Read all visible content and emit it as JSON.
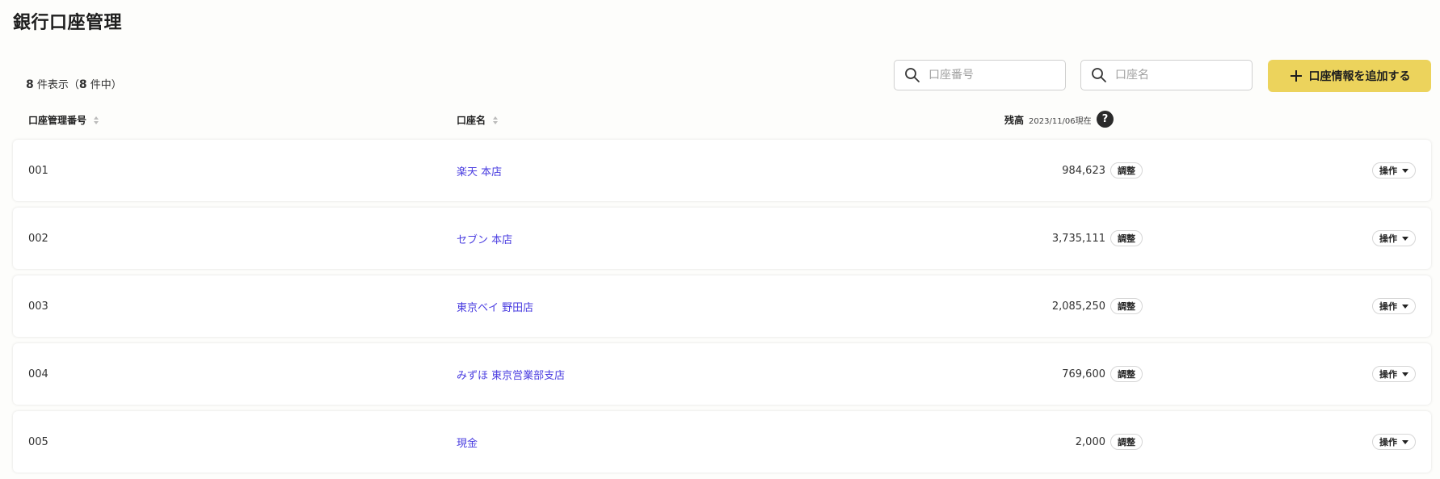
{
  "page": {
    "title": "銀行口座管理"
  },
  "summary": {
    "shown": "8",
    "shown_suffix": " 件表示（",
    "total": "8",
    "total_suffix": " 件中）"
  },
  "search": {
    "account_number_placeholder": "口座番号",
    "account_name_placeholder": "口座名"
  },
  "add_button": {
    "label": "口座情報を追加する"
  },
  "table": {
    "headers": {
      "account_no": "口座管理番号",
      "account_name": "口座名",
      "balance": "残高",
      "balance_date": "2023/11/06現在"
    },
    "help": "?",
    "adjust_label": "調整",
    "operation_label": "操作",
    "rows": [
      {
        "no": "001",
        "name": "楽天 本店",
        "balance": "984,623"
      },
      {
        "no": "002",
        "name": "セブン 本店",
        "balance": "3,735,111"
      },
      {
        "no": "003",
        "name": "東京ベイ 野田店",
        "balance": "2,085,250"
      },
      {
        "no": "004",
        "name": "みずほ 東京営業部支店",
        "balance": "769,600"
      },
      {
        "no": "005",
        "name": "現金",
        "balance": "2,000"
      }
    ]
  },
  "colors": {
    "accent": "#ecd35c",
    "link": "#4a3de0",
    "background": "#fdfdfb"
  }
}
